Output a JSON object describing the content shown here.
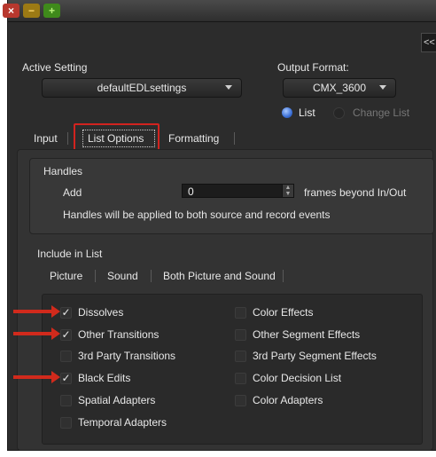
{
  "titlebar": {
    "close": "×",
    "minimize": "−",
    "maximize": "+"
  },
  "collapse_label": "<<",
  "active_setting": {
    "label": "Active Setting",
    "value": "defaultEDLsettings"
  },
  "output_format": {
    "label": "Output Format:",
    "value": "CMX_3600",
    "radio_list": "List",
    "radio_change": "Change List"
  },
  "tabs": [
    "Input",
    "List Options",
    "Formatting"
  ],
  "handles": {
    "title": "Handles",
    "add_label": "Add",
    "value": "0",
    "suffix": "frames beyond In/Out",
    "note": "Handles will be applied to both source and record events"
  },
  "include": {
    "title": "Include in List",
    "subtabs": [
      "Picture",
      "Sound",
      "Both Picture and Sound"
    ],
    "left": [
      {
        "label": "Dissolves",
        "checked": true
      },
      {
        "label": "Other Transitions",
        "checked": true
      },
      {
        "label": "3rd Party Transitions",
        "checked": false
      },
      {
        "label": "Black Edits",
        "checked": true
      },
      {
        "label": "Spatial Adapters",
        "checked": false
      },
      {
        "label": "Temporal Adapters",
        "checked": false
      }
    ],
    "right": [
      {
        "label": "Color Effects",
        "checked": false
      },
      {
        "label": "Other Segment Effects",
        "checked": false
      },
      {
        "label": "3rd Party Segment Effects",
        "checked": false
      },
      {
        "label": "Color Decision List",
        "checked": false
      },
      {
        "label": "Color Adapters",
        "checked": false
      }
    ]
  },
  "colors": {
    "window_bg": "#2c2c2c",
    "highlight": "#d2231f",
    "arrow": "#d12a1c",
    "radio_on": "#3b6fd6"
  }
}
